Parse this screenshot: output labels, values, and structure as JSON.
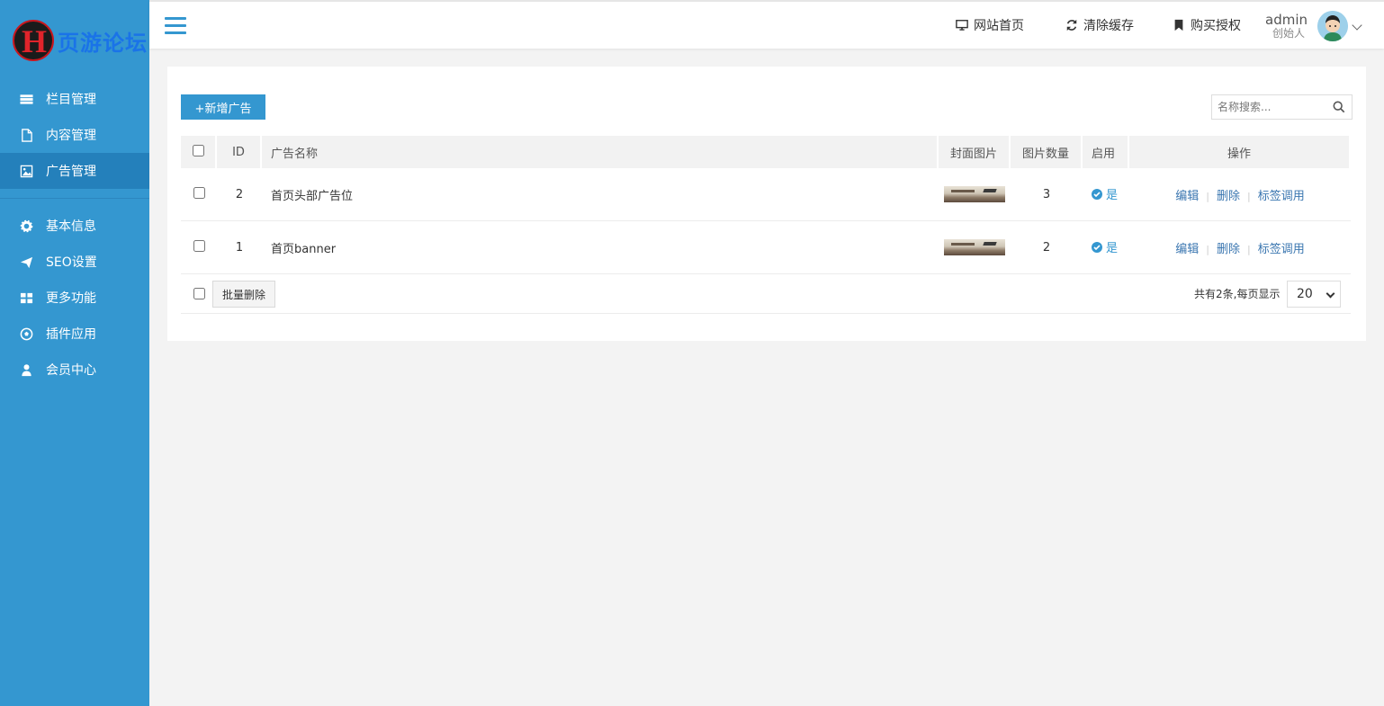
{
  "logo": {
    "mark": "H",
    "text": "页游论坛"
  },
  "sidebar": {
    "items": [
      {
        "label": "栏目管理",
        "icon": "list-icon"
      },
      {
        "label": "内容管理",
        "icon": "file-icon"
      },
      {
        "label": "广告管理",
        "icon": "image-icon",
        "active": true
      },
      {
        "label": "基本信息",
        "icon": "gear-icon"
      },
      {
        "label": "SEO设置",
        "icon": "paper-plane-icon"
      },
      {
        "label": "更多功能",
        "icon": "grid-icon"
      },
      {
        "label": "插件应用",
        "icon": "soccer-ball-icon"
      },
      {
        "label": "会员中心",
        "icon": "user-icon"
      }
    ]
  },
  "topbar": {
    "home": "网站首页",
    "clear_cache": "清除缓存",
    "buy_license": "购买授权",
    "user_name": "admin",
    "user_role": "创始人"
  },
  "toolbar": {
    "add_label": "+新增广告",
    "search_placeholder": "名称搜索..."
  },
  "table": {
    "headers": {
      "id": "ID",
      "name": "广告名称",
      "cover": "封面图片",
      "count": "图片数量",
      "enabled": "启用",
      "actions": "操作"
    },
    "rows": [
      {
        "id": "2",
        "name": "首页头部广告位",
        "count": "3",
        "enabled": "是"
      },
      {
        "id": "1",
        "name": "首页banner",
        "count": "2",
        "enabled": "是"
      }
    ],
    "actions": {
      "edit": "编辑",
      "delete": "删除",
      "tag": "标签调用"
    }
  },
  "footer": {
    "batch_delete": "批量删除",
    "summary": "共有2条,每页显示",
    "page_size": "20"
  },
  "colors": {
    "accent": "#3497d0",
    "sidebar_active": "#2480bb",
    "link": "#3a76b0"
  }
}
